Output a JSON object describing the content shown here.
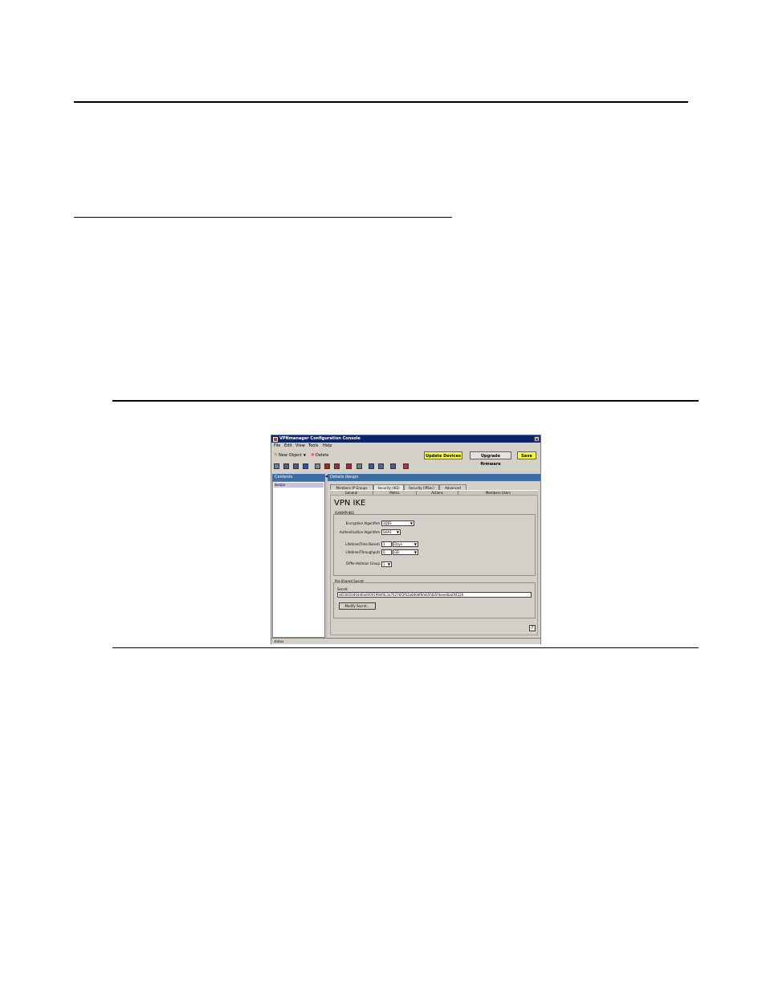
{
  "window": {
    "title": "VPNmanager Configuration Console",
    "close_glyph": "×"
  },
  "menu": [
    "File",
    "Edit",
    "View",
    "Tools",
    "Help"
  ],
  "toolbar": {
    "new_object": "New Object",
    "delete": "Delete",
    "update_devices": "Update Devices",
    "upgrade_firmware": "Upgrade firmware",
    "save": "Save"
  },
  "panes": {
    "contents_title": "Contents",
    "details_title": "Details  ikevpn"
  },
  "tree": {
    "items": [
      "ikevpn"
    ]
  },
  "tabs": [
    "Members IP Groups",
    "Security (IKE)",
    "Security (IPSec)",
    "Advanced"
  ],
  "subtabs": [
    "General",
    "Metric",
    "Actions",
    "Members Users"
  ],
  "isakmp": {
    "heading": "VPN IKE",
    "group_label": "ISAKMP(IKE)",
    "encryption_label": "Encryption Algorithm",
    "encryption_value": "3DES",
    "authentication_label": "Authentication Algorithm",
    "authentication_value": "SHA1",
    "lifetime_time_label": "Lifetime(Time Based)",
    "lifetime_time_value": "1",
    "lifetime_time_unit": "Days",
    "lifetime_throughput_label": "Lifetime(Throughput)",
    "lifetime_throughput_value": "0",
    "lifetime_throughput_unit": "GB",
    "dh_label": "Diffie-Hellman Group",
    "dh_value": "1"
  },
  "preshared": {
    "group_label": "Pre-Shared Secret",
    "secret_label": "Secret",
    "secret_value": "d650020d04d0a00001994f4c3a76276f2f02a8d0df6feb5f4b5f4eee0ba0f4226",
    "modify_button": "Modify Secret..."
  },
  "status": {
    "text": "status"
  },
  "colors": {
    "title_bar": "#0a246a",
    "pane_header": "#3a6ea5",
    "highlight_button": "#ffff33"
  }
}
